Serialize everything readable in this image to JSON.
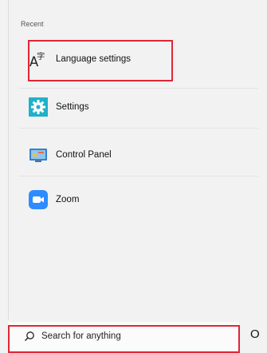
{
  "section_title": "Recent",
  "items": [
    {
      "label": "Language settings",
      "icon": "language-icon"
    },
    {
      "label": "Settings",
      "icon": "gear-icon"
    },
    {
      "label": "Control Panel",
      "icon": "control-panel-icon"
    },
    {
      "label": "Zoom",
      "icon": "zoom-icon"
    }
  ],
  "search": {
    "placeholder": "Search for anything"
  },
  "cortana_glyph": "O",
  "colors": {
    "highlight": "#e02636",
    "settings_icon": "#1fb1c9",
    "zoom_icon": "#2d8cff"
  }
}
